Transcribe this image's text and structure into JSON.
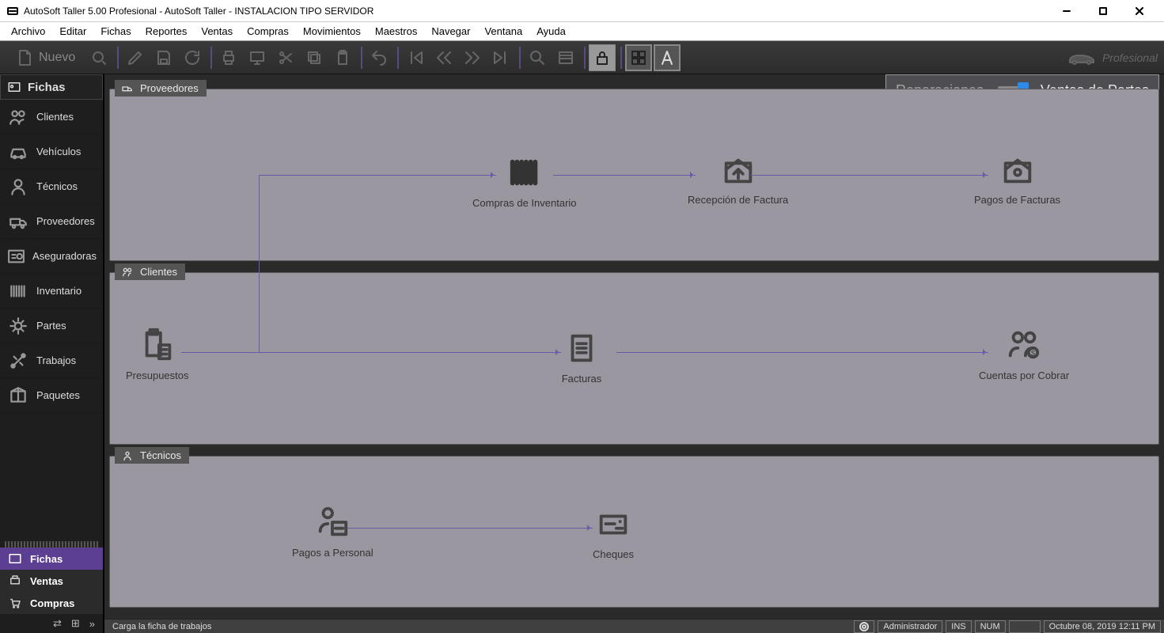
{
  "window": {
    "title": "AutoSoft Taller 5.00 Profesional - AutoSoft Taller - INSTALACION TIPO SERVIDOR"
  },
  "menu": [
    "Archivo",
    "Editar",
    "Fichas",
    "Reportes",
    "Ventas",
    "Compras",
    "Movimientos",
    "Maestros",
    "Navegar",
    "Ventana",
    "Ayuda"
  ],
  "toolbar": {
    "nuevo": "Nuevo",
    "brand": "Profesional"
  },
  "sidebar": {
    "header": "Fichas",
    "items": [
      {
        "label": "Clientes"
      },
      {
        "label": "Vehículos"
      },
      {
        "label": "Técnicos"
      },
      {
        "label": "Proveedores"
      },
      {
        "label": "Aseguradoras"
      },
      {
        "label": "Inventario"
      },
      {
        "label": "Partes"
      },
      {
        "label": "Trabajos"
      },
      {
        "label": "Paquetes"
      }
    ],
    "tabs": [
      {
        "label": "Fichas"
      },
      {
        "label": "Ventas"
      },
      {
        "label": "Compras"
      }
    ]
  },
  "toggle": {
    "left": "Reparaciones",
    "right": "Ventas de Partes"
  },
  "panels": {
    "proveedores": {
      "title": "Proveedores",
      "nodes": {
        "compras": "Compras de Inventario",
        "recepcion": "Recepción de Factura",
        "pagos": "Pagos de Facturas"
      }
    },
    "clientes": {
      "title": "Clientes",
      "nodes": {
        "presupuestos": "Presupuestos",
        "facturas": "Facturas",
        "cuentas": "Cuentas por Cobrar"
      }
    },
    "tecnicos": {
      "title": "Técnicos",
      "nodes": {
        "pagos": "Pagos a Personal",
        "cheques": "Cheques"
      }
    }
  },
  "status": {
    "hint": "Carga la ficha de trabajos",
    "user": "Administrador",
    "ins": "INS",
    "num": "NUM",
    "datetime": "Octubre 08, 2019 12:11 PM"
  }
}
